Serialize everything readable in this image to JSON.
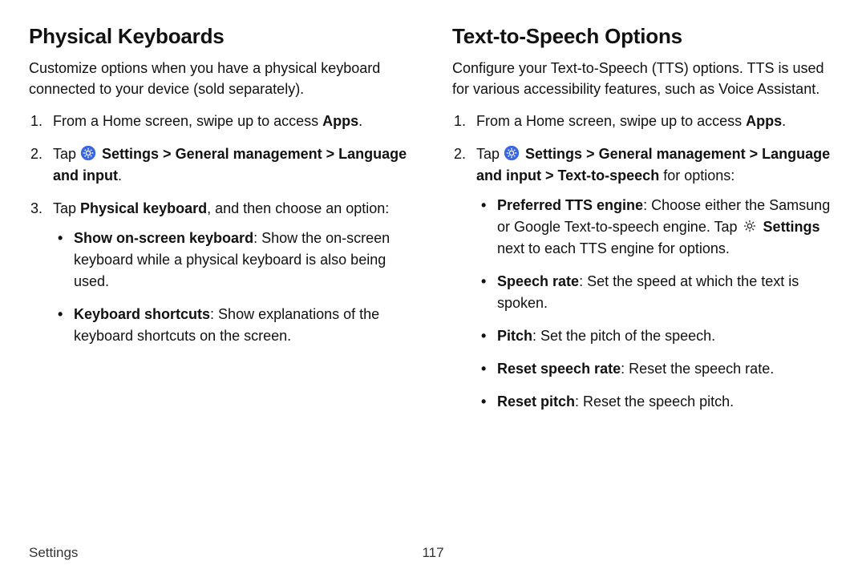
{
  "footer": {
    "section": "Settings",
    "page": "117"
  },
  "left": {
    "heading": "Physical Keyboards",
    "intro": "Customize options when you have a physical keyboard connected to your device (sold separately).",
    "step1_pre": "From a Home screen, swipe up to access ",
    "step1_apps": "Apps",
    "step1_post": ".",
    "step2_pre": "Tap ",
    "step2_settings": " Settings",
    "step2_sep1": " > ",
    "step2_gm": "General management",
    "step2_sep2": " > ",
    "step2_li": "Language and input",
    "step2_post": ".",
    "step3_pre": "Tap ",
    "step3_pk": "Physical keyboard",
    "step3_post": ", and then choose an option:",
    "b1_label": "Show on-screen keyboard",
    "b1_text": ": Show the on-screen keyboard while a physical keyboard is also being used.",
    "b2_label": "Keyboard shortcuts",
    "b2_text": ": Show explanations of the keyboard shortcuts on the screen."
  },
  "right": {
    "heading": "Text-to-Speech Options",
    "intro": "Configure your Text-to-Speech (TTS) options. TTS is used for various accessibility features, such as Voice Assistant.",
    "step1_pre": "From a Home screen, swipe up to access ",
    "step1_apps": "Apps",
    "step1_post": ".",
    "step2_pre": "Tap ",
    "step2_settings": " Settings",
    "step2_sep1": " > ",
    "step2_gm": "General management",
    "step2_sep2": " > ",
    "step2_li": "Language and input",
    "step2_sep3": " > ",
    "step2_tts": "Text-to-speech",
    "step2_post": " for options:",
    "b1_label": "Preferred TTS engine",
    "b1_text_a": ": Choose either the Samsung or Google Text-to-speech engine. Tap ",
    "b1_settings": " Settings",
    "b1_text_b": " next to each TTS engine for options.",
    "b2_label": "Speech rate",
    "b2_text": ": Set the speed at which the text is spoken.",
    "b3_label": "Pitch",
    "b3_text": ": Set the pitch of the speech.",
    "b4_label": "Reset speech rate",
    "b4_text": ": Reset the speech rate.",
    "b5_label": "Reset pitch",
    "b5_text": ": Reset the speech pitch."
  }
}
